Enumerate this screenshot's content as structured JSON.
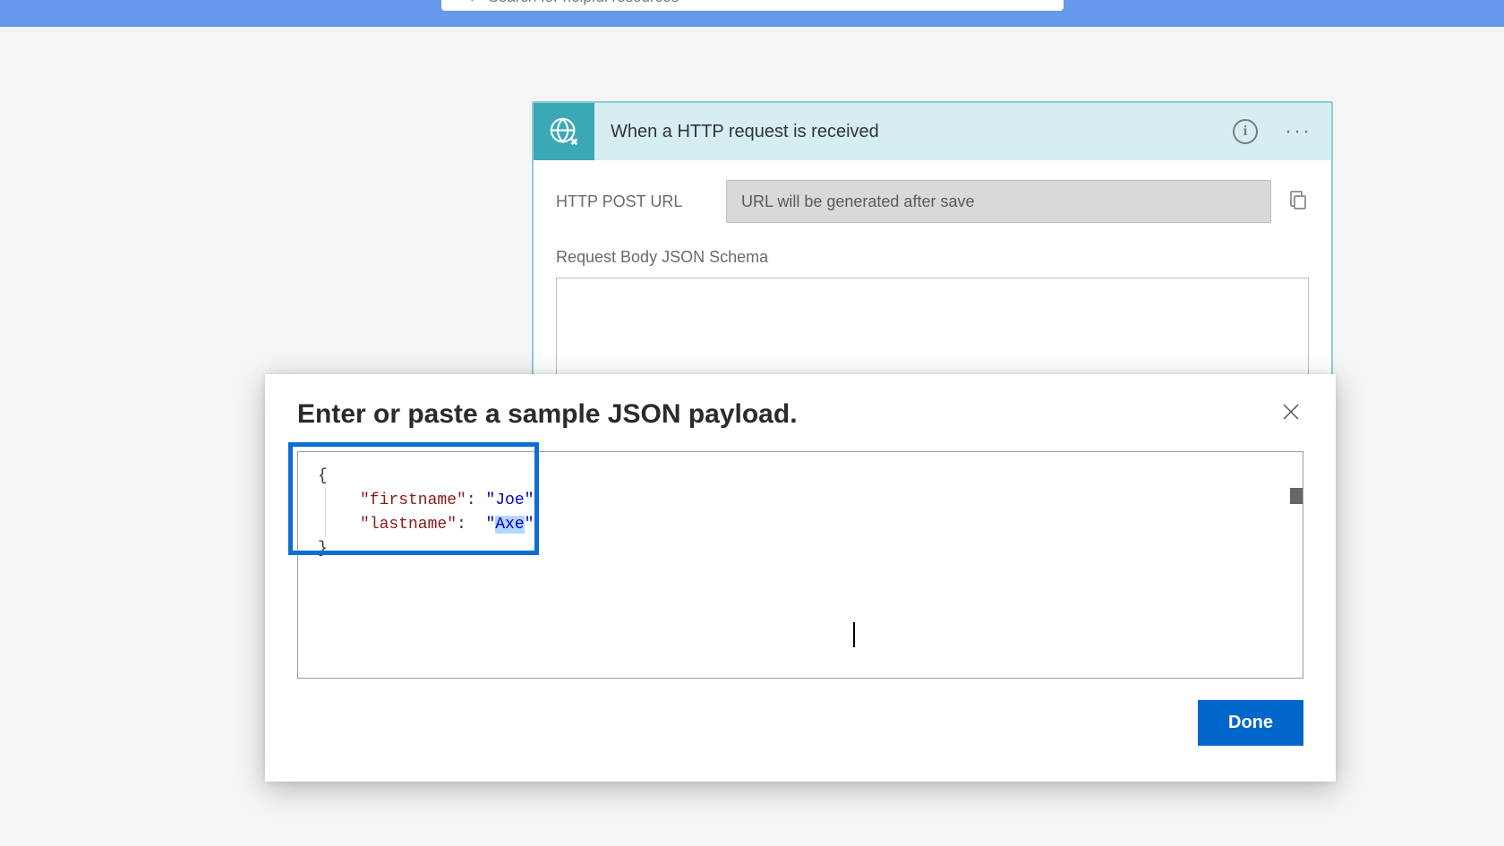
{
  "topbar": {
    "search_placeholder": "Search for helpful resources"
  },
  "trigger": {
    "title": "When a HTTP request is received",
    "url_label": "HTTP POST URL",
    "url_placeholder": "URL will be generated after save",
    "schema_label": "Request Body JSON Schema"
  },
  "modal": {
    "title": "Enter or paste a sample JSON payload.",
    "done_label": "Done",
    "json_payload": {
      "line1_key": "\"firstname\"",
      "line1_val": "\"Joe\"",
      "line2_key": "\"lastname\"",
      "line2_val_open": "\"",
      "line2_val_text": "Axe",
      "line2_val_close": "\""
    }
  }
}
